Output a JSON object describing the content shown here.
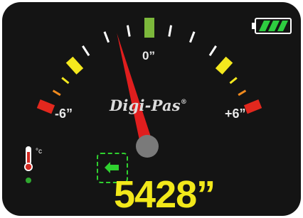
{
  "gauge": {
    "brand": "Digi-Pas",
    "registered": "®",
    "label_left": "-6”",
    "label_zero": "0”",
    "label_right": "+6”",
    "reading": "5428”",
    "needle_angle_deg": -15,
    "colors": {
      "background": "#141414",
      "center_tick": "#7cb83b",
      "yellow_tick": "#f4e81e",
      "orange_tick": "#f08a1e",
      "red_tick": "#e2281e",
      "white_tick": "#ffffff",
      "needle": "#e01e1e",
      "hub": "#7a7a7a",
      "reading": "#f2e81a",
      "indicator_green": "#2fd02f"
    }
  },
  "status": {
    "temperature_unit": "°c",
    "battery_level": 1.0,
    "direction_indicator": "left-arrow-icon",
    "thermometer_icon": "thermometer-icon"
  }
}
